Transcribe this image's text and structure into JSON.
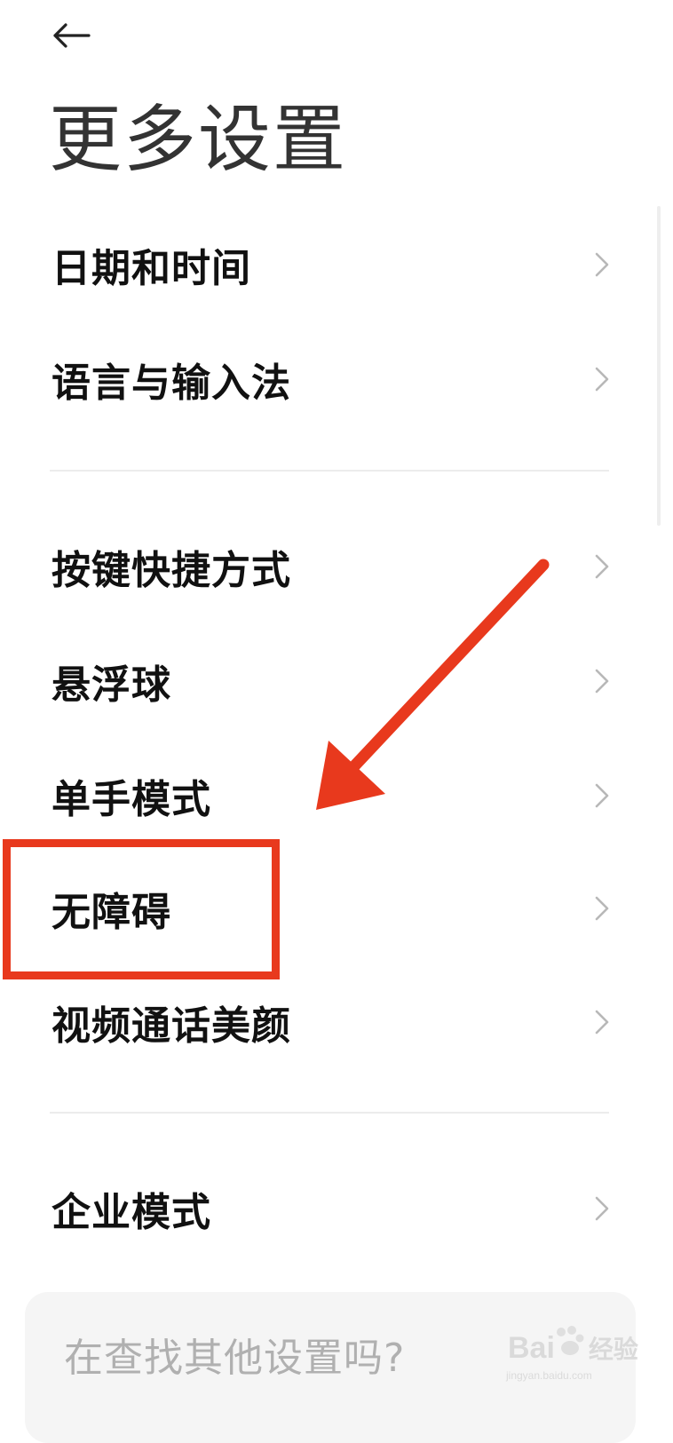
{
  "header": {
    "title": "更多设置"
  },
  "settings_list": [
    {
      "label": "日期和时间"
    },
    {
      "label": "语言与输入法"
    },
    {
      "label": "按键快捷方式"
    },
    {
      "label": "悬浮球"
    },
    {
      "label": "单手模式"
    },
    {
      "label": "无障碍"
    },
    {
      "label": "视频通话美颜"
    },
    {
      "label": "企业模式"
    }
  ],
  "search": {
    "prompt": "在查找其他设置吗?"
  },
  "annotation": {
    "color": "#e8391d",
    "target": "无障碍"
  },
  "watermark": {
    "brand": "Bai",
    "brand_suffix": "经验",
    "domain": "jingyan.baidu.com"
  },
  "colors": {
    "background": "#ffffff",
    "title": "#333333",
    "label": "#111111",
    "chevron": "#b8b8b8",
    "divider": "#ececec",
    "search_bg": "#f5f5f5",
    "search_text": "#b0b0b0"
  }
}
